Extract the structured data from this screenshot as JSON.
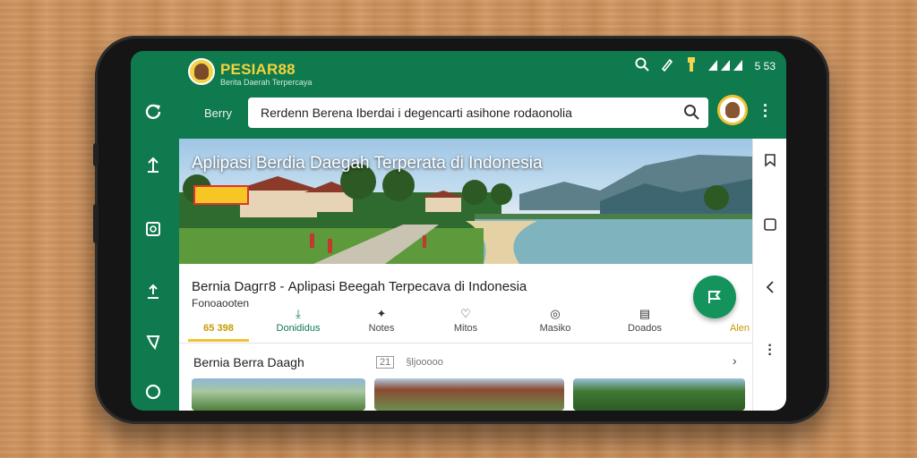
{
  "app": {
    "brand": "PESIAR88",
    "subtitle": "Berita Daerah Terpercaya",
    "status_time": "5 53"
  },
  "search": {
    "menu_label": "Berry",
    "query": "Rerdenn Berena Iberdai i degencarti asihone rodaonolia"
  },
  "hero": {
    "title": "Aplipasi Berdia Daegah Terperata di Indonesia"
  },
  "post": {
    "title": "Bernia Dagгг8 - Aplipasi Beegah Terpecava di Indonesia",
    "subtitle": "Fonoaooten"
  },
  "tabs": [
    {
      "label": "65 398",
      "icon": "",
      "active": true
    },
    {
      "label": "Donididus",
      "icon": "download-icon",
      "active": false
    },
    {
      "label": "Notes",
      "icon": "pin-icon",
      "active": false
    },
    {
      "label": "Mitos",
      "icon": "heart-icon",
      "active": false
    },
    {
      "label": "Masiko",
      "icon": "location-icon",
      "active": false
    },
    {
      "label": "Doados",
      "icon": "document-icon",
      "active": false
    },
    {
      "label": "Alen",
      "icon": "",
      "active": false
    }
  ],
  "section": {
    "title": "Bernia Berra Daagh",
    "count": "21",
    "meta": "§ljooooo"
  },
  "colors": {
    "primary": "#0f7a4e",
    "accent": "#f1c232",
    "fab": "#14945c",
    "tab_active_text": "#c79a00"
  }
}
